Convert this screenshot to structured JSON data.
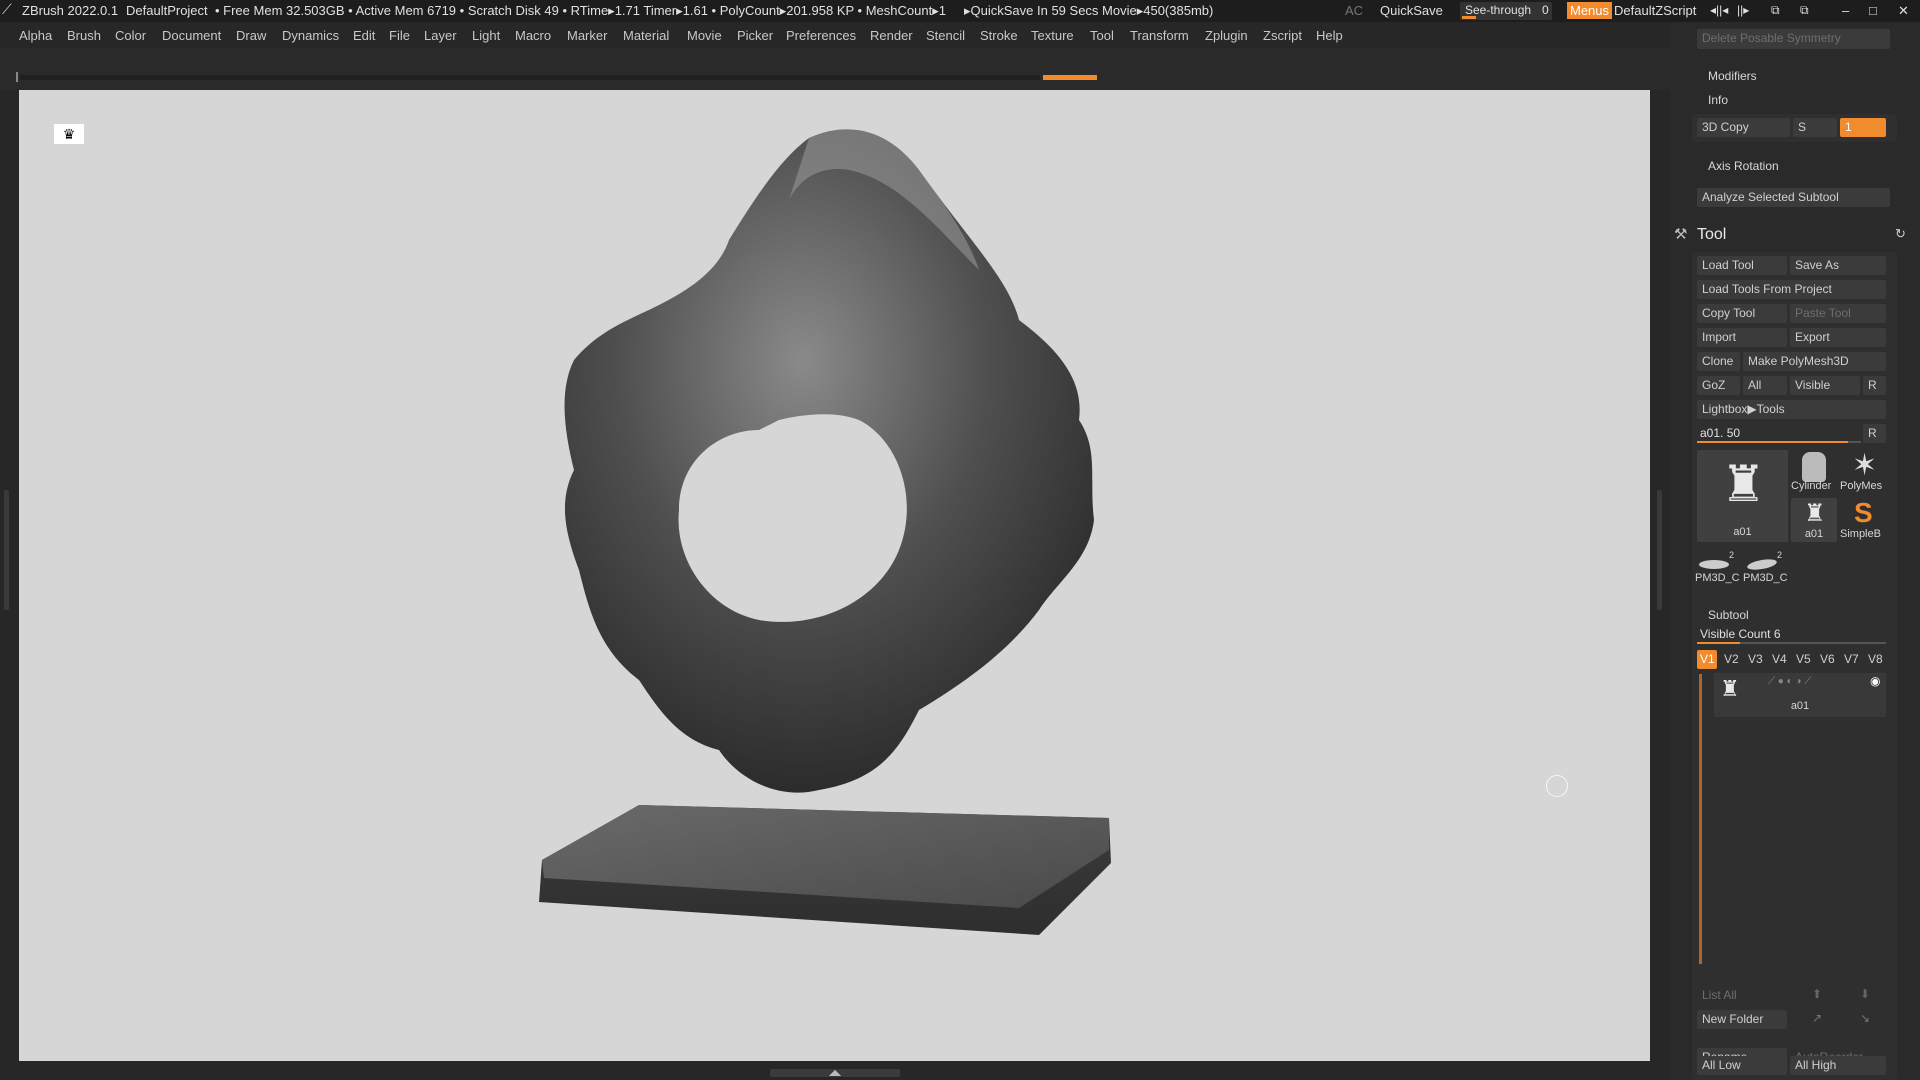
{
  "titlebar": {
    "app": "ZBrush 2022.0.1",
    "project": "DefaultProject",
    "stats": "• Free Mem 32.503GB • Active Mem 6719 • Scratch Disk 49 • RTime▸1.71 Timer▸1.61 • PolyCount▸201.958 KP • MeshCount▸1",
    "quicksave_status": "▸QuickSave In 59 Secs Movie▸450(385mb)",
    "ac": "AC",
    "quicksave": "QuickSave",
    "see_through": "See-through",
    "see_through_value": "0",
    "menus": "Menus",
    "zscript": "DefaultZScript"
  },
  "menubar": {
    "items": [
      "Alpha",
      "Brush",
      "Color",
      "Document",
      "Draw",
      "Dynamics",
      "Edit",
      "File",
      "Layer",
      "Light",
      "Macro",
      "Marker",
      "Material",
      "Movie",
      "Picker",
      "Preferences",
      "Render",
      "Stencil",
      "Stroke",
      "Texture",
      "Tool",
      "Transform",
      "Zplugin",
      "Zscript",
      "Help"
    ]
  },
  "panel": {
    "delete_posable_symmetry": "Delete Posable Symmetry",
    "modifiers": "Modifiers",
    "info": "Info",
    "copy3d": "3D Copy",
    "copy3d_s": "S",
    "copy3d_value": "1",
    "axis_rotation": "Axis Rotation",
    "analyze_subtool": "Analyze Selected Subtool",
    "tool_title": "Tool",
    "load_tool": "Load Tool",
    "save_as": "Save As",
    "load_tools_project": "Load Tools From Project",
    "copy_tool": "Copy Tool",
    "paste_tool": "Paste Tool",
    "import": "Import",
    "export": "Export",
    "clone": "Clone",
    "make_polymesh": "Make PolyMesh3D",
    "goz": "GoZ",
    "all": "All",
    "visible": "Visible",
    "r": "R",
    "lightbox_tools": "Lightbox▶Tools",
    "tool_slider": "a01. 50",
    "tool_slider_value": 0.92,
    "thumbs": [
      {
        "name": "a01",
        "icon": "sculpt-icon"
      },
      {
        "name": "Cylinder",
        "icon": "cylinder-icon"
      },
      {
        "name": "PolyMes",
        "icon": "star-icon"
      },
      {
        "name": "a01",
        "icon": "sculpt-icon"
      },
      {
        "name": "SimpleB",
        "icon": "simple-brush-icon"
      },
      {
        "name": "PM3D_C",
        "icon": "pm3d-icon",
        "count": "2"
      },
      {
        "name": "PM3D_C",
        "icon": "pm3d-icon",
        "count": "2"
      }
    ],
    "subtool_title": "Subtool",
    "visible_count": "Visible Count 6",
    "visible_count_value": 0.23,
    "versions": [
      "V1",
      "V2",
      "V3",
      "V4",
      "V5",
      "V6",
      "V7",
      "V8"
    ],
    "subtool_item": "a01",
    "list_all": "List All",
    "new_folder": "New Folder",
    "rename": "Rename",
    "auto_reorder": "AutoReorder",
    "all_low": "All Low",
    "all_high": "All High"
  },
  "colors": {
    "accent": "#f28a2e",
    "viewport_bg": "#d6d6d6",
    "panel_bg": "#2a2a2a",
    "button_bg": "#3b3b3b"
  }
}
